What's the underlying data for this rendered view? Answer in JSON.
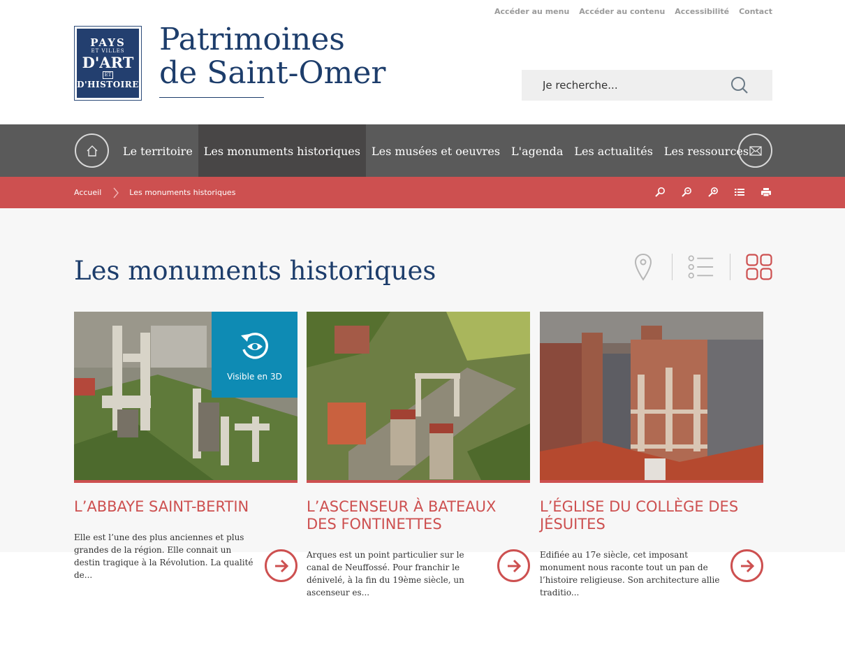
{
  "utility_links": [
    "Accéder au menu",
    "Accéder au contenu",
    "Accessibilité",
    "Contact"
  ],
  "logo": {
    "line1": "PAYS",
    "line2": "ET VILLES",
    "line3": "D'ART",
    "line4": "ET",
    "line5": "D'HISTOIRE"
  },
  "site_title": {
    "line1": "Patrimoines",
    "line2": "de Saint-Omer"
  },
  "search": {
    "placeholder": "Je recherche..."
  },
  "nav": {
    "items": [
      {
        "label": "Le territoire",
        "active": false
      },
      {
        "label": "Les monuments historiques",
        "active": true
      },
      {
        "label": "Les musées et oeuvres",
        "active": false
      },
      {
        "label": "L'agenda",
        "active": false
      },
      {
        "label": "Les actualités",
        "active": false
      },
      {
        "label": "Les ressources",
        "active": false
      }
    ]
  },
  "breadcrumb": {
    "home": "Accueil",
    "current": "Les monuments historiques"
  },
  "page_title": "Les monuments historiques",
  "cards": [
    {
      "title": "L’ABBAYE SAINT-BERTIN",
      "text": "Elle est l’une des plus anciennes et plus grandes de la région. Elle connait un destin tragique à la Révolution. La qualité de...",
      "badge": "Visible en 3D"
    },
    {
      "title": "L’ASCENSEUR À BATEAUX DES FONTINETTES",
      "text": "Arques est un point particulier sur le canal de Neuffossé. Pour franchir le dénivelé, à la fin du 19ème siècle, un ascenseur es..."
    },
    {
      "title": "L’ÉGLISE DU COLLÈGE DES JÉSUITES",
      "text": "Edifiée au 17e siècle, cet imposant monument nous raconte tout un pan de l’histoire religieuse. Son architecture allie traditio..."
    }
  ],
  "colors": {
    "navy": "#1d3d6b",
    "accent": "#cd5050",
    "nav_bg": "#5a5a5a",
    "badge": "#0e8bb4"
  }
}
